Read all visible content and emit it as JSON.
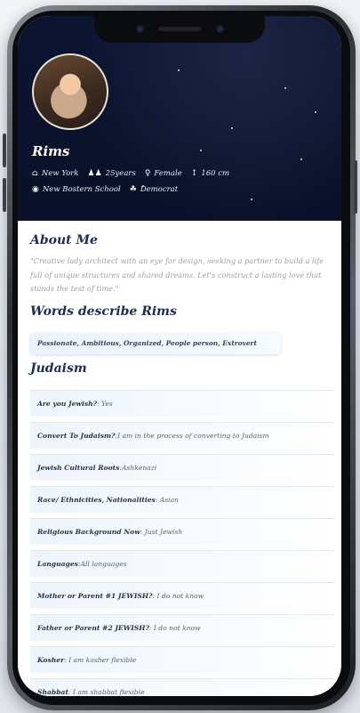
{
  "profile": {
    "name": "Rims",
    "location": "New York",
    "age": "25years",
    "gender": "Female",
    "height": "160 cm",
    "school": "New Bostern School",
    "politics": "Democrat"
  },
  "about": {
    "title": "About Me",
    "text": "\"Creative lady architect with an eye for design, seeking a partner to build a life full of unique structures and shared dreams. Let's construct a lasting love that stands the test of time.\""
  },
  "words": {
    "title": "Words describe Rims",
    "list": "Passionate, Ambitious, Organized, People person, Extrovert"
  },
  "judaism": {
    "title": "Judaism",
    "items": [
      {
        "q": "Are you Jewish?",
        "a": ": Yes"
      },
      {
        "q": "Convert To Judaism?",
        "a": ":I am in the process of converting to Judaism"
      },
      {
        "q": "Jewish Cultural Roots",
        "a": ":Ashkenazi"
      },
      {
        "q": "Race/ Ethnicities, Nationalities",
        "a": ": Asian"
      },
      {
        "q": "Religious Background Now",
        "a": ": Just Jewish"
      },
      {
        "q": "Languages",
        "a": ":All languages"
      },
      {
        "q": "Mother or Parent #1 JEWISH?",
        "a": ": I do not know"
      },
      {
        "q": "Father or Parent #2 JEWISH?",
        "a": ": I do not know"
      },
      {
        "q": "Kosher",
        "a": ": I am kosher flexible"
      },
      {
        "q": "Shabbat",
        "a": ": I am shabbat flexible"
      }
    ]
  },
  "icons": {
    "location": "home-icon",
    "age": "people-icon",
    "gender": "female-icon",
    "height": "height-icon",
    "school": "graduation-cap-icon",
    "politics": "politics-icon"
  },
  "colors": {
    "hero_bg": "#0d1430",
    "heading": "#1d2d52",
    "card_bg": "#eef5fb"
  }
}
